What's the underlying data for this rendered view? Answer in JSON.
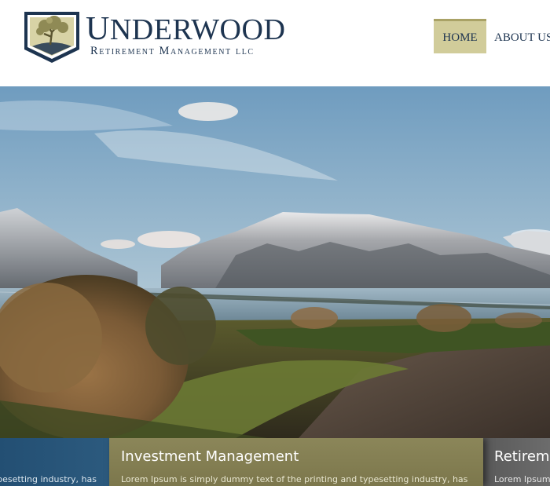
{
  "brand": {
    "name_initial": "U",
    "name_rest": "NDERWOOD",
    "subtitle": "Retirement Management llc"
  },
  "nav": {
    "items": [
      {
        "label": "HOME",
        "active": true
      },
      {
        "label": "ABOUT US",
        "active": false
      }
    ]
  },
  "hero": {
    "image": "mountain-lake-landscape"
  },
  "features": [
    {
      "title": "",
      "text": "typesetting industry, has",
      "color": "#2a5679"
    },
    {
      "title": "Investment Management",
      "text": "Lorem Ipsum is simply dummy text of the printing and typesetting industry, has",
      "color": "#837e52"
    },
    {
      "title": "Retirement",
      "text": "Lorem Ipsum",
      "color": "#636363"
    }
  ],
  "colors": {
    "brand_navy": "#1d3450",
    "nav_active": "#d1cc9a",
    "accent_olive": "#837e52"
  }
}
